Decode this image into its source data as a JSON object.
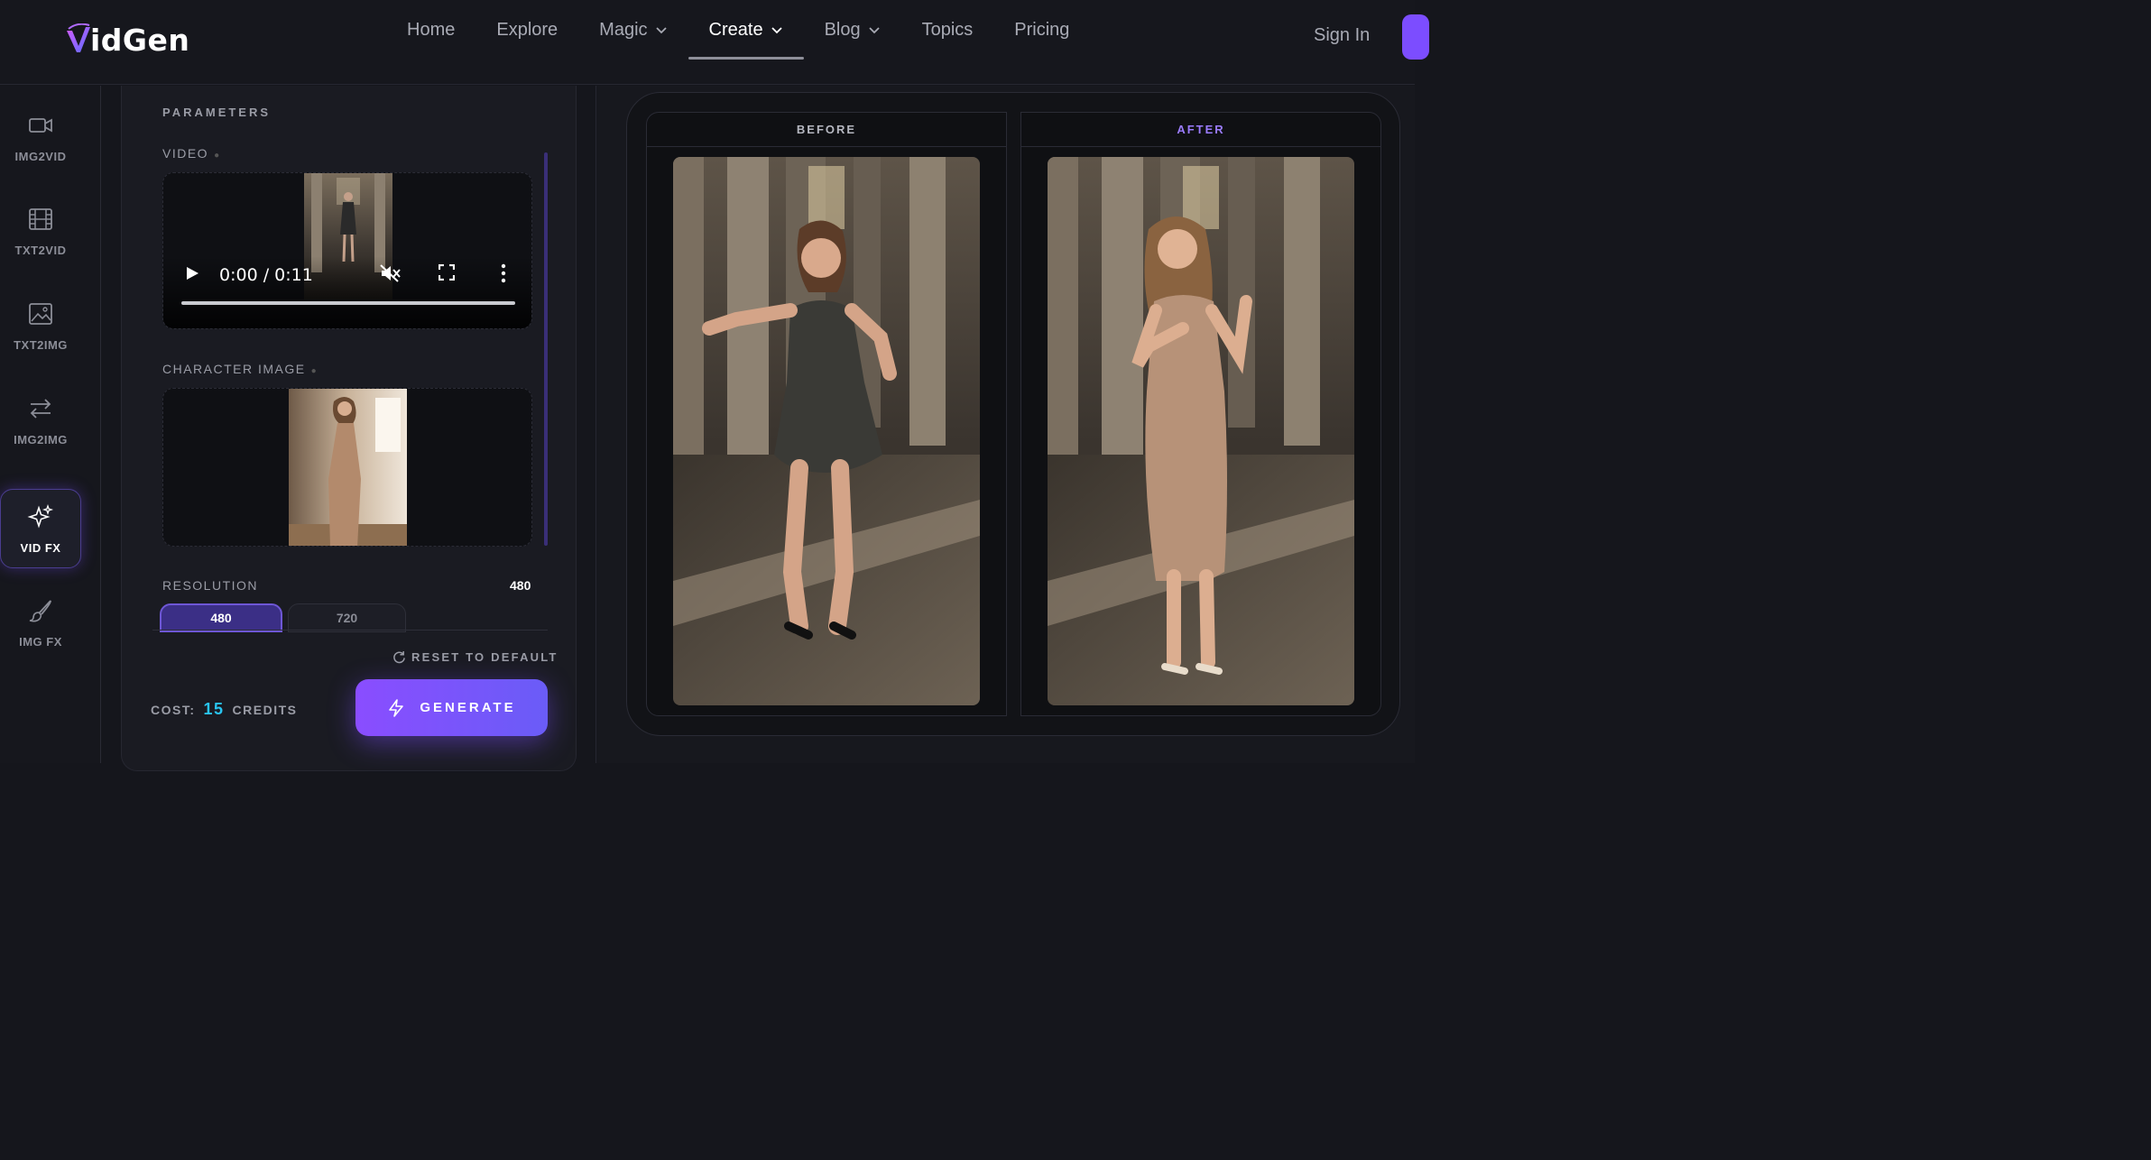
{
  "brand": {
    "name": "idGen",
    "mark": "V"
  },
  "nav": {
    "items": [
      {
        "label": "Home",
        "dropdown": false
      },
      {
        "label": "Explore",
        "dropdown": false
      },
      {
        "label": "Magic",
        "dropdown": true
      },
      {
        "label": "Create",
        "dropdown": true,
        "active": true
      },
      {
        "label": "Blog",
        "dropdown": true
      },
      {
        "label": "Topics",
        "dropdown": false
      },
      {
        "label": "Pricing",
        "dropdown": false
      }
    ],
    "sign_in": "Sign In"
  },
  "rail": {
    "items": [
      {
        "label": "IMG2VID",
        "icon": "video-camera-icon"
      },
      {
        "label": "TXT2VID",
        "icon": "film-icon"
      },
      {
        "label": "TXT2IMG",
        "icon": "image-icon"
      },
      {
        "label": "IMG2IMG",
        "icon": "swap-arrows-icon"
      },
      {
        "label": "VID FX",
        "icon": "sparkles-icon",
        "active": true
      },
      {
        "label": "IMG FX",
        "icon": "brush-icon"
      }
    ]
  },
  "params": {
    "title": "PARAMETERS",
    "video_label": "VIDEO",
    "video_time": "0:00 / 0:11",
    "character_label": "CHARACTER IMAGE",
    "resolution_label": "RESOLUTION",
    "resolution_value": "480",
    "resolution_options": [
      "480",
      "720"
    ],
    "reset_label": "RESET TO DEFAULT",
    "cost_prefix": "COST:",
    "cost_value": "15",
    "cost_suffix": "CREDITS",
    "generate_label": "GENERATE"
  },
  "compare": {
    "before_label": "BEFORE",
    "after_label": "AFTER"
  },
  "colors": {
    "accent": "#7c4dff",
    "credit_number": "#29c4f0",
    "after_label": "#9b7cff"
  }
}
